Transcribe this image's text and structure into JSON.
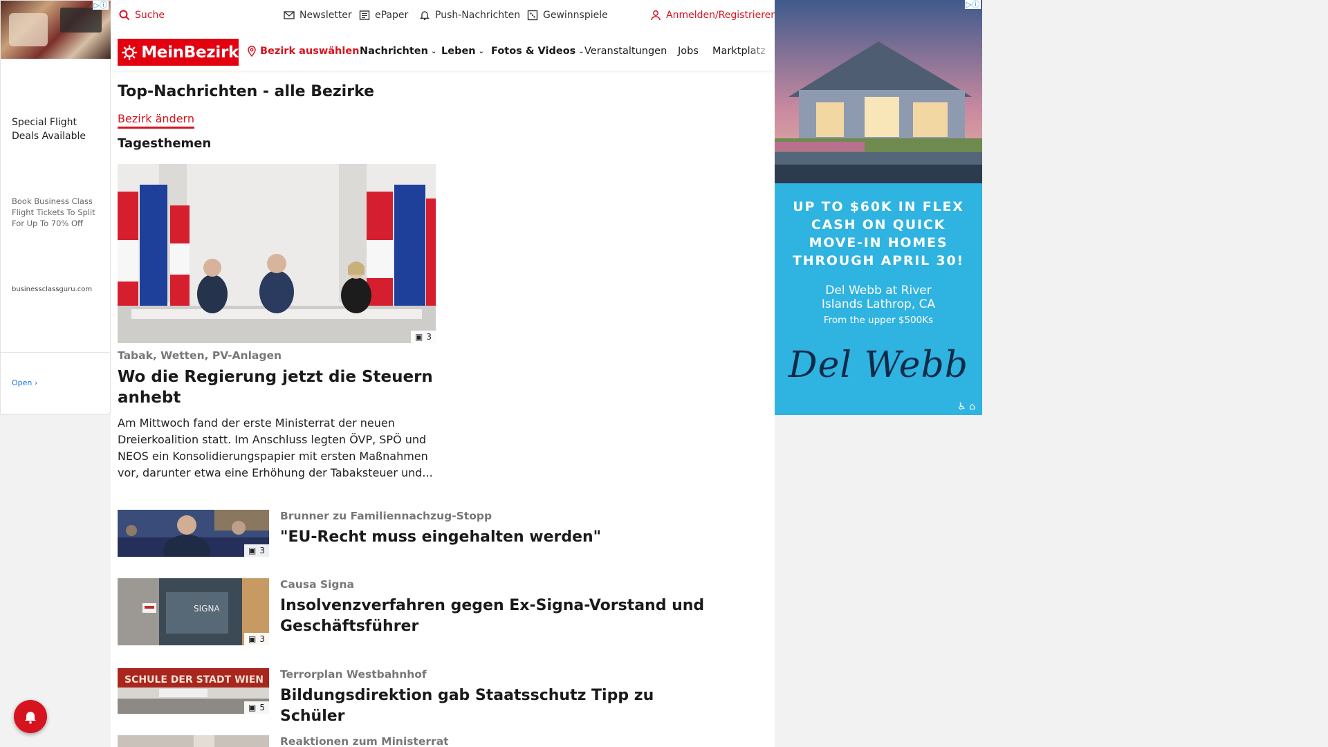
{
  "topbar": {
    "search_label": "Suche",
    "newsletter_label": "Newsletter",
    "epaper_label": "ePaper",
    "push_label": "Push-Nachrichten",
    "gewinnspiele_label": "Gewinnspiele",
    "login_label": "Anmelden/Registrieren"
  },
  "navbar": {
    "logo_text": "MeinBezirk",
    "bezirk_label": "Bezirk auswählen",
    "items": [
      {
        "label": "Nachrichten"
      },
      {
        "label": "Leben"
      },
      {
        "label": "Fotos & Videos"
      },
      {
        "label": "Veranstaltungen"
      },
      {
        "label": "Jobs"
      },
      {
        "label": "Marktplatz"
      }
    ]
  },
  "page": {
    "title": "Top-Nachrichten - alle Bezirke",
    "change_link": "Bezirk ändern",
    "section_title": "Tagesthemen"
  },
  "hero": {
    "image_count": "3",
    "kicker": "Tabak, Wetten, PV-Anlagen",
    "title": "Wo die Regierung jetzt die Steuern anhebt",
    "teaser": "Am Mittwoch fand der erste Ministerrat der neuen Dreierkoalition statt. Im Anschluss legten ÖVP, SPÖ und NEOS ein Konsolidierungspapier mit ersten Maßnahmen vor, darunter etwa eine Erhöhung der Tabaksteuer und..."
  },
  "articles": [
    {
      "kicker": "Brunner zu Familiennachzug-Stopp",
      "title": "\"EU-Recht muss eingehalten werden\"",
      "image_count": "3"
    },
    {
      "kicker": "Causa Signa",
      "title": "Insolvenzverfahren gegen Ex-Signa-Vorstand und Geschäftsführer",
      "image_count": "3"
    },
    {
      "kicker": "Terrorplan Westbahnhof",
      "title": "Bildungsdirektion gab Staatsschutz Tipp zu Schüler",
      "image_count": "5"
    },
    {
      "kicker": "Reaktionen zum Ministerrat",
      "title": "",
      "image_count": ""
    }
  ],
  "left_ad": {
    "headline": "Special Flight Deals Available",
    "description": "Book Business Class Flight Tickets To Split For Up To 70% Off",
    "url": "businessclassguru.com",
    "open_label": "Open"
  },
  "right_ad": {
    "headline_lines": "UP TO $60K IN FLEX CASH ON QUICK MOVE-IN HOMES THROUGH APRIL 30!",
    "place": "Del Webb at River Islands Lathrop, CA",
    "price": "From the upper $500Ks",
    "brand": "Del Webb"
  },
  "colors": {
    "brand_red": "#e3000f",
    "link_red": "#d6141f",
    "ad_blue": "#2fb3e0"
  }
}
